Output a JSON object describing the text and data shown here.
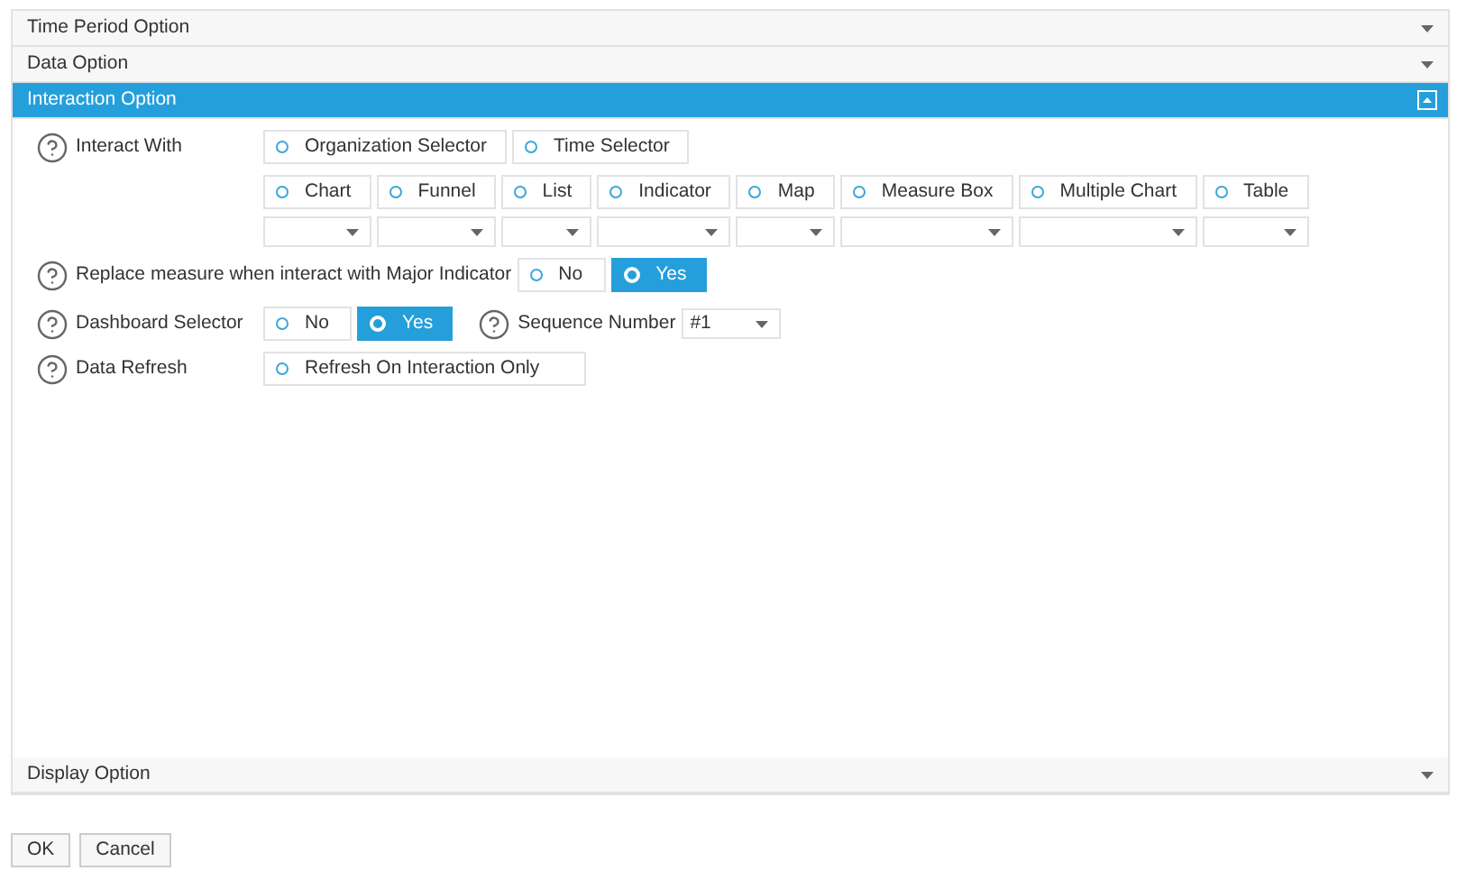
{
  "sections_top": [
    {
      "title": "Time Period Option",
      "expanded": false
    },
    {
      "title": "Data Option",
      "expanded": false
    },
    {
      "title": "Interaction Option",
      "expanded": true
    }
  ],
  "interact_with": {
    "label": "Interact With",
    "options": [
      {
        "label": "Organization Selector",
        "selected": false
      },
      {
        "label": "Time Selector",
        "selected": false
      }
    ],
    "components": [
      {
        "label": "Chart",
        "selected": false
      },
      {
        "label": "Funnel",
        "selected": false
      },
      {
        "label": "List",
        "selected": false
      },
      {
        "label": "Indicator",
        "selected": false
      },
      {
        "label": "Map",
        "selected": false
      },
      {
        "label": "Measure Box",
        "selected": false
      },
      {
        "label": "Multiple Chart",
        "selected": false
      },
      {
        "label": "Table",
        "selected": false
      }
    ]
  },
  "replace_measure": {
    "label": "Replace measure when interact with Major Indicator",
    "options": [
      {
        "label": "No",
        "selected": false
      },
      {
        "label": "Yes",
        "selected": true
      }
    ]
  },
  "dashboard_selector": {
    "label": "Dashboard Selector",
    "options": [
      {
        "label": "No",
        "selected": false
      },
      {
        "label": "Yes",
        "selected": true
      }
    ],
    "sequence_label": "Sequence Number",
    "sequence_value": "#1"
  },
  "data_refresh": {
    "label": "Data Refresh",
    "options": [
      {
        "label": "Refresh On Interaction Only",
        "selected": false
      }
    ]
  },
  "sections_bottom": [
    {
      "title": "Display Option",
      "expanded": false
    }
  ],
  "buttons": [
    "OK",
    "Cancel"
  ]
}
